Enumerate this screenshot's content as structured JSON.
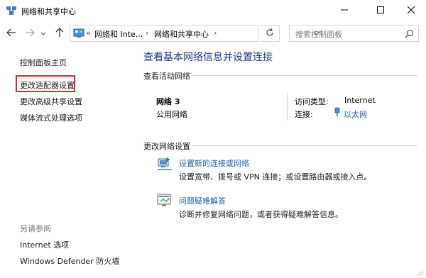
{
  "window": {
    "title": "网络和共享中心",
    "app_icon": "network-sharing-icon",
    "controls": [
      "minimize-icon",
      "maximize-icon",
      "close-icon"
    ]
  },
  "navigation": {
    "back_icon": "arrow-left-icon",
    "forward_icon": "arrow-right-icon",
    "recent_icon": "chevron-down-icon",
    "up_icon": "arrow-up-icon",
    "breadcrumb": {
      "overflow": "«",
      "items": [
        "网络和 Inte...",
        "网络和共享中心"
      ],
      "separator": "›"
    },
    "refresh_icon": "refresh-icon",
    "search": {
      "placeholder": "搜索控制面板",
      "icon": "search-icon"
    }
  },
  "sidebar": {
    "links": [
      "控制面板主页",
      "更改适配器设置",
      "更改高级共享设置",
      "媒体流式处理选项"
    ],
    "highlighted": "更改适配器设置",
    "highlight_color": "#e0282e",
    "see_also": {
      "heading": "另请参阅",
      "links": [
        "Internet 选项",
        "Windows Defender 防火墙"
      ]
    }
  },
  "main": {
    "title": "查看基本网络信息并设置连接",
    "active_networks": {
      "heading": "查看活动网络",
      "network_name": "网络 3",
      "network_category": "公用网络",
      "access_type_label": "访问类型:",
      "access_type_value": "Internet",
      "connections_label": "连接:",
      "connection_link": "以太网"
    },
    "change_settings": {
      "heading": "更改网络设置",
      "tasks": [
        {
          "icon": "new-connection-icon",
          "link": "设置新的连接或网络",
          "description": "设置宽带、拨号或 VPN 连接；或设置路由器或接入点。"
        },
        {
          "icon": "troubleshoot-icon",
          "link": "问题疑难解答",
          "description": "诊断并修复网络问题，或者获得疑难解答信息。"
        }
      ]
    }
  },
  "colors": {
    "title_blue": "#1e3287",
    "link_blue": "#1a5fb4"
  }
}
